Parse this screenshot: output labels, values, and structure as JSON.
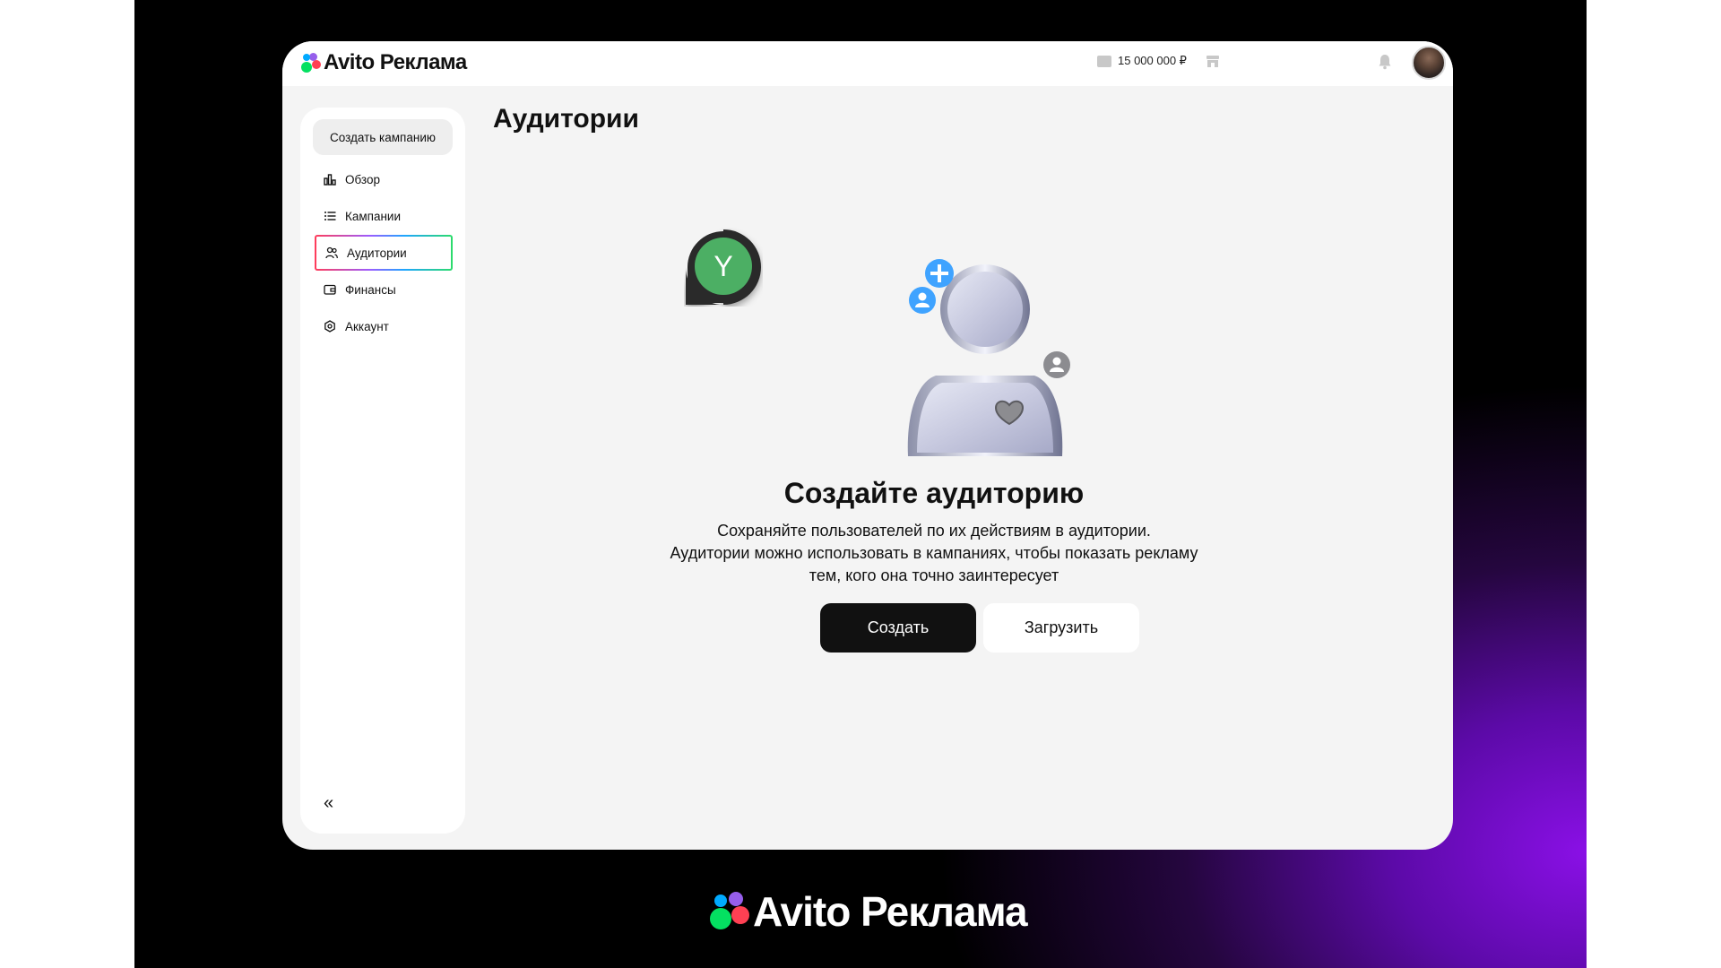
{
  "header": {
    "logo_text": "Avito Реклама",
    "balance": "15 000 000 ₽"
  },
  "sidebar": {
    "create_campaign_label": "Создать кампанию",
    "items": [
      {
        "label": "Обзор",
        "icon": "chart-icon"
      },
      {
        "label": "Кампании",
        "icon": "list-icon"
      },
      {
        "label": "Аудитории",
        "icon": "users-icon",
        "active": true
      },
      {
        "label": "Финансы",
        "icon": "wallet-icon"
      },
      {
        "label": "Аккаунт",
        "icon": "gear-icon"
      }
    ],
    "collapse_label": "«"
  },
  "main": {
    "page_title": "Аудитории",
    "bubble_letter": "Y",
    "empty_title": "Создайте аудиторию",
    "empty_desc_line1": "Сохраняйте пользователей по их действиям в аудитории.",
    "empty_desc_line2": "Аудитории можно использовать в кампаниях, чтобы показать рекламу",
    "empty_desc_line3": "тем, кого она точно заинтересует",
    "create_button": "Создать",
    "upload_button": "Загрузить"
  },
  "footer": {
    "logo_text": "Avito Реклама"
  },
  "colors": {
    "accent_dark": "#111111",
    "bubble_green": "#4caf64",
    "purple_glow": "#8a10e6"
  }
}
